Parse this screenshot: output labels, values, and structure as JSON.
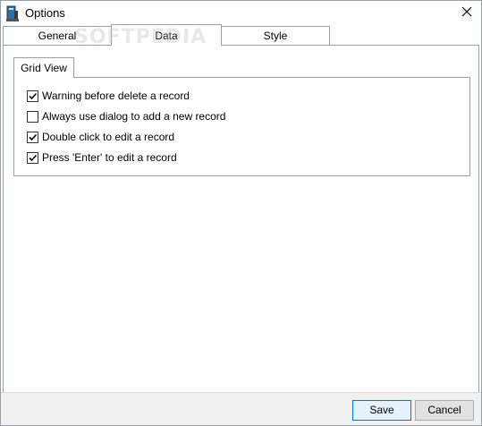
{
  "window": {
    "title": "Options"
  },
  "tabs": [
    {
      "label": "General"
    },
    {
      "label": "Data"
    },
    {
      "label": "Style"
    }
  ],
  "watermark": "SOFTPEDIA",
  "group": {
    "title": "Grid View",
    "options": [
      {
        "label": "Warning before delete a record",
        "checked": true
      },
      {
        "label": "Always use dialog to add a new record",
        "checked": false
      },
      {
        "label": "Double click to edit a record",
        "checked": true
      },
      {
        "label": "Press 'Enter' to edit a record",
        "checked": true
      }
    ]
  },
  "buttons": {
    "save": "Save",
    "cancel": "Cancel"
  },
  "colors": {
    "accent": "#0078d7"
  }
}
